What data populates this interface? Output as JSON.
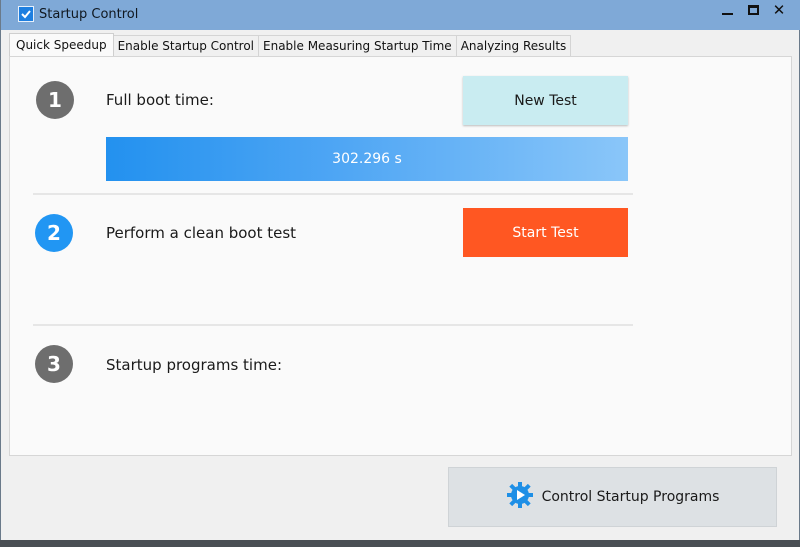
{
  "window": {
    "title": "Startup Control"
  },
  "tabs": [
    {
      "label": "Quick Speedup",
      "active": true
    },
    {
      "label": "Enable Startup Control",
      "active": false
    },
    {
      "label": "Enable Measuring Startup Time",
      "active": false
    },
    {
      "label": "Analyzing Results",
      "active": false
    }
  ],
  "steps": [
    {
      "number": "1",
      "label": "Full boot time:",
      "button": "New Test",
      "progress_text": "302.296 s",
      "progress_fraction": 1.0
    },
    {
      "number": "2",
      "label": "Perform a clean boot test",
      "button": "Start Test"
    },
    {
      "number": "3",
      "label": "Startup programs time:"
    }
  ],
  "bottom": {
    "control_button": "Control Startup Programs"
  },
  "colors": {
    "titlebar": "#7fa9d7",
    "step_gray": "#6e6e6e",
    "step_blue": "#2196f3",
    "start_button": "#ff5722",
    "new_button": "#c9ecf1",
    "progress_start": "#2391ef",
    "progress_end": "#8ac6f9"
  },
  "icons": {
    "app": "checkmark-icon",
    "control": "play-gear-icon"
  }
}
